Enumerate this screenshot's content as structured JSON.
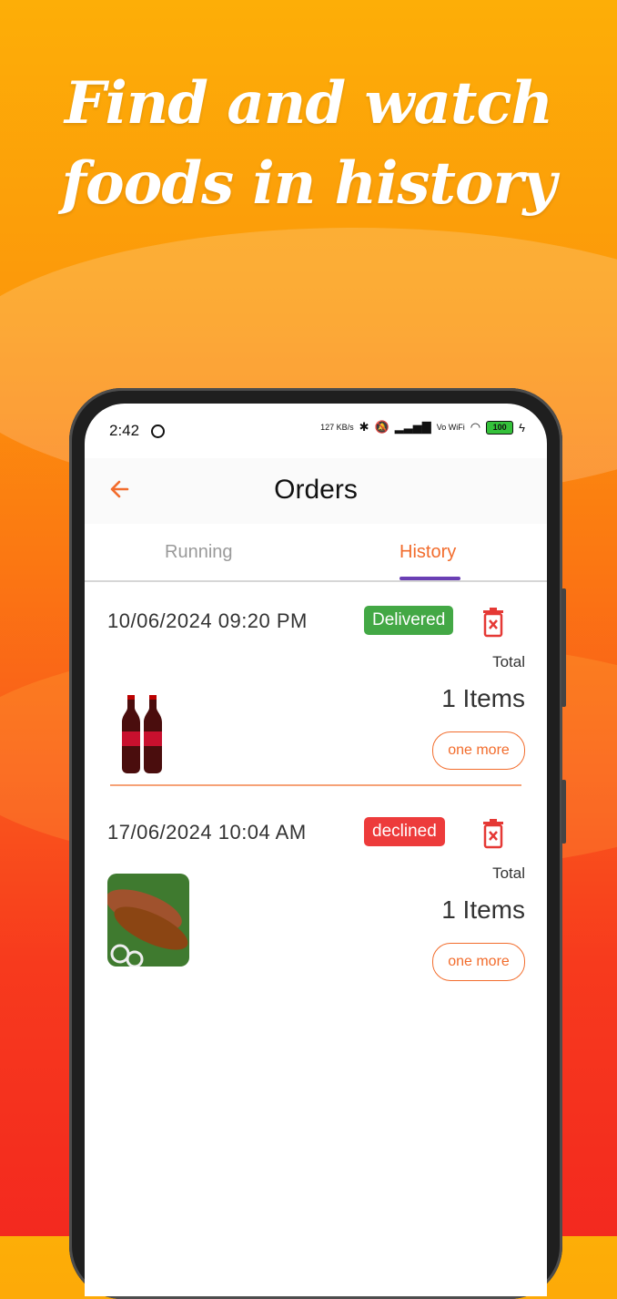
{
  "headline": {
    "line1": "Find and watch",
    "line2": "foods in history"
  },
  "status_bar": {
    "time": "2:42",
    "net_speed": "127 KB/s",
    "signal": "Vo WiFi",
    "battery": "100"
  },
  "app_bar": {
    "title": "Orders",
    "back_icon": "arrow-left-icon"
  },
  "tabs": [
    {
      "label": "Running"
    },
    {
      "label": "History"
    }
  ],
  "colors": {
    "accent": "#f26c2c",
    "tab_indicator": "#6a3fb4",
    "delivered": "#43a845",
    "declined": "#ed3b3b"
  },
  "orders": [
    {
      "datetime": "10/06/2024 09:20 PM",
      "status": "Delivered",
      "total_label": "Total",
      "items": "1 Items",
      "more_label": "one more",
      "thumb": "cola-bottles-image"
    },
    {
      "datetime": "17/06/2024 10:04 AM",
      "status": "declined",
      "total_label": "Total",
      "items": "1 Items",
      "more_label": "one more",
      "thumb": "grilled-fish-image"
    }
  ]
}
